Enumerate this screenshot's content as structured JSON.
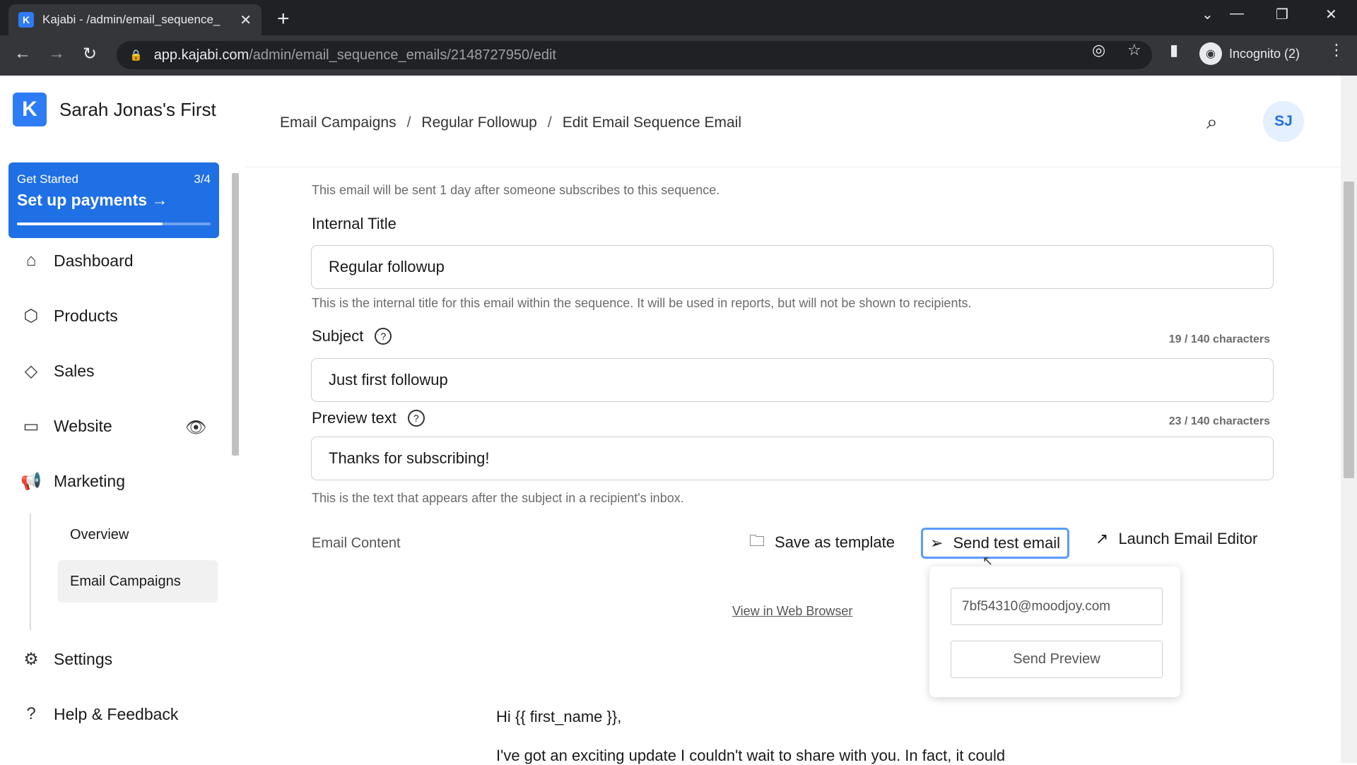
{
  "browser": {
    "tab_title": "Kajabi - /admin/email_sequence_",
    "url_host": "app.kajabi.com",
    "url_path": "/admin/email_sequence_emails/2148727950/edit",
    "incognito_label": "Incognito (2)"
  },
  "sidebar": {
    "site_name": "Sarah Jonas's First",
    "get_started": {
      "label": "Get Started",
      "progress_text": "3/4",
      "title": "Set up payments",
      "progress": 0.75
    },
    "nav": [
      {
        "label": "Dashboard",
        "icon": "home-icon"
      },
      {
        "label": "Products",
        "icon": "box-icon"
      },
      {
        "label": "Sales",
        "icon": "tag-icon"
      },
      {
        "label": "Website",
        "icon": "monitor-icon"
      },
      {
        "label": "Marketing",
        "icon": "megaphone-icon"
      }
    ],
    "marketing_sub": [
      {
        "label": "Overview"
      },
      {
        "label": "Email Campaigns"
      }
    ],
    "settings_label": "Settings",
    "help_label": "Help & Feedback"
  },
  "header": {
    "breadcrumbs": [
      "Email Campaigns",
      "Regular Followup",
      "Edit Email Sequence Email"
    ],
    "avatar_initials": "SJ"
  },
  "form": {
    "schedule_help": "This email will be sent 1 day after someone subscribes to this sequence.",
    "internal_title": {
      "label": "Internal Title",
      "value": "Regular followup",
      "help": "This is the internal title for this email within the sequence. It will be used in reports, but will not be shown to recipients."
    },
    "subject": {
      "label": "Subject",
      "value": "Just first followup",
      "count": "19 / 140 characters"
    },
    "preview": {
      "label": "Preview text",
      "value": "Thanks for subscribing!",
      "count": "23 / 140 characters",
      "help": "This is the text that appears after the subject in a recipient's inbox."
    },
    "email_content_label": "Email Content",
    "save_template": "Save as template",
    "send_test": "Send test email",
    "launch_editor": "Launch Email Editor"
  },
  "popover": {
    "email": "7bf54310@moodjoy.com",
    "send_preview": "Send Preview"
  },
  "email_body": {
    "view_web": "View in Web Browser",
    "greeting": "Hi {{ first_name }},",
    "line1": "I've got an exciting update I couldn't wait to share with you. In fact, it could"
  },
  "colors": {
    "brand": "#2e7bf6",
    "accent": "#1f6fe5"
  }
}
